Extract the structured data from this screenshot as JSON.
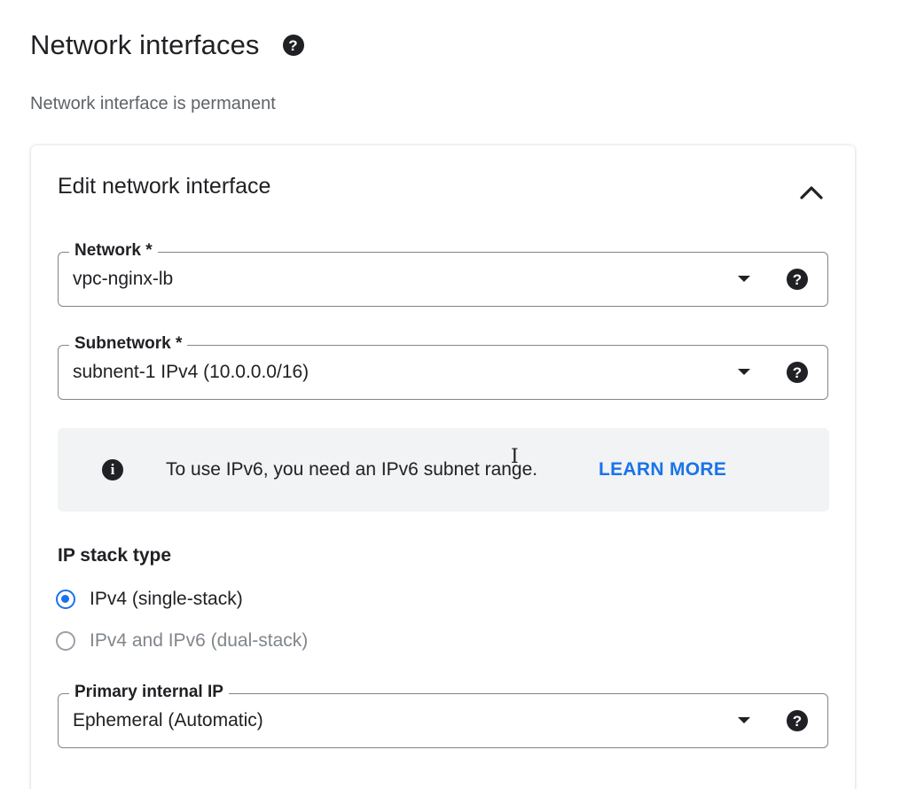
{
  "section": {
    "title": "Network interfaces",
    "subtitle": "Network interface is permanent"
  },
  "card": {
    "header": "Edit network interface",
    "network": {
      "label": "Network *",
      "value": "vpc-nginx-lb"
    },
    "subnetwork": {
      "label": "Subnetwork *",
      "value": "subnent-1 IPv4 (10.0.0.0/16)"
    },
    "info": {
      "text": "To use IPv6, you need an IPv6 subnet range.",
      "link": "LEARN MORE"
    },
    "ip_stack": {
      "label": "IP stack type",
      "options": [
        {
          "label": "IPv4 (single-stack)",
          "selected": true,
          "enabled": true
        },
        {
          "label": "IPv4 and IPv6 (dual-stack)",
          "selected": false,
          "enabled": false
        }
      ]
    },
    "primary_ip": {
      "label": "Primary internal IP",
      "value": "Ephemeral (Automatic)"
    }
  },
  "icons": {
    "help": "help-circle-icon",
    "info": "info-circle-icon",
    "collapse": "chevron-up-icon",
    "dropdown": "caret-down-icon"
  },
  "colors": {
    "accent": "#1a73e8",
    "text": "#202124",
    "secondary_text": "#5f6368",
    "info_background": "#f1f3f4"
  }
}
